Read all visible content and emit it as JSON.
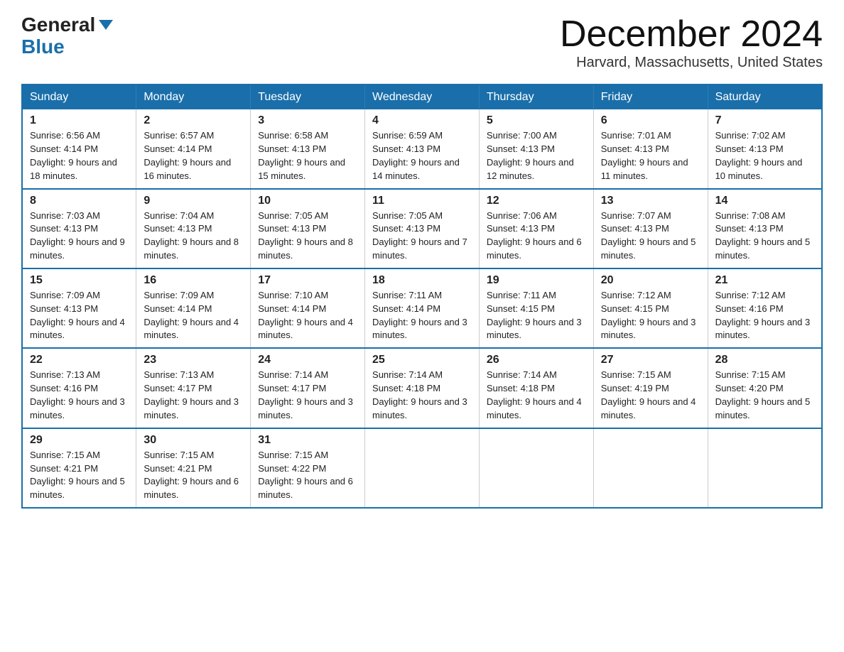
{
  "header": {
    "logo_general": "General",
    "logo_blue": "Blue",
    "month_title": "December 2024",
    "location": "Harvard, Massachusetts, United States"
  },
  "weekdays": [
    "Sunday",
    "Monday",
    "Tuesday",
    "Wednesday",
    "Thursday",
    "Friday",
    "Saturday"
  ],
  "weeks": [
    [
      {
        "day": "1",
        "sunrise": "6:56 AM",
        "sunset": "4:14 PM",
        "daylight": "9 hours and 18 minutes."
      },
      {
        "day": "2",
        "sunrise": "6:57 AM",
        "sunset": "4:14 PM",
        "daylight": "9 hours and 16 minutes."
      },
      {
        "day": "3",
        "sunrise": "6:58 AM",
        "sunset": "4:13 PM",
        "daylight": "9 hours and 15 minutes."
      },
      {
        "day": "4",
        "sunrise": "6:59 AM",
        "sunset": "4:13 PM",
        "daylight": "9 hours and 14 minutes."
      },
      {
        "day": "5",
        "sunrise": "7:00 AM",
        "sunset": "4:13 PM",
        "daylight": "9 hours and 12 minutes."
      },
      {
        "day": "6",
        "sunrise": "7:01 AM",
        "sunset": "4:13 PM",
        "daylight": "9 hours and 11 minutes."
      },
      {
        "day": "7",
        "sunrise": "7:02 AM",
        "sunset": "4:13 PM",
        "daylight": "9 hours and 10 minutes."
      }
    ],
    [
      {
        "day": "8",
        "sunrise": "7:03 AM",
        "sunset": "4:13 PM",
        "daylight": "9 hours and 9 minutes."
      },
      {
        "day": "9",
        "sunrise": "7:04 AM",
        "sunset": "4:13 PM",
        "daylight": "9 hours and 8 minutes."
      },
      {
        "day": "10",
        "sunrise": "7:05 AM",
        "sunset": "4:13 PM",
        "daylight": "9 hours and 8 minutes."
      },
      {
        "day": "11",
        "sunrise": "7:05 AM",
        "sunset": "4:13 PM",
        "daylight": "9 hours and 7 minutes."
      },
      {
        "day": "12",
        "sunrise": "7:06 AM",
        "sunset": "4:13 PM",
        "daylight": "9 hours and 6 minutes."
      },
      {
        "day": "13",
        "sunrise": "7:07 AM",
        "sunset": "4:13 PM",
        "daylight": "9 hours and 5 minutes."
      },
      {
        "day": "14",
        "sunrise": "7:08 AM",
        "sunset": "4:13 PM",
        "daylight": "9 hours and 5 minutes."
      }
    ],
    [
      {
        "day": "15",
        "sunrise": "7:09 AM",
        "sunset": "4:13 PM",
        "daylight": "9 hours and 4 minutes."
      },
      {
        "day": "16",
        "sunrise": "7:09 AM",
        "sunset": "4:14 PM",
        "daylight": "9 hours and 4 minutes."
      },
      {
        "day": "17",
        "sunrise": "7:10 AM",
        "sunset": "4:14 PM",
        "daylight": "9 hours and 4 minutes."
      },
      {
        "day": "18",
        "sunrise": "7:11 AM",
        "sunset": "4:14 PM",
        "daylight": "9 hours and 3 minutes."
      },
      {
        "day": "19",
        "sunrise": "7:11 AM",
        "sunset": "4:15 PM",
        "daylight": "9 hours and 3 minutes."
      },
      {
        "day": "20",
        "sunrise": "7:12 AM",
        "sunset": "4:15 PM",
        "daylight": "9 hours and 3 minutes."
      },
      {
        "day": "21",
        "sunrise": "7:12 AM",
        "sunset": "4:16 PM",
        "daylight": "9 hours and 3 minutes."
      }
    ],
    [
      {
        "day": "22",
        "sunrise": "7:13 AM",
        "sunset": "4:16 PM",
        "daylight": "9 hours and 3 minutes."
      },
      {
        "day": "23",
        "sunrise": "7:13 AM",
        "sunset": "4:17 PM",
        "daylight": "9 hours and 3 minutes."
      },
      {
        "day": "24",
        "sunrise": "7:14 AM",
        "sunset": "4:17 PM",
        "daylight": "9 hours and 3 minutes."
      },
      {
        "day": "25",
        "sunrise": "7:14 AM",
        "sunset": "4:18 PM",
        "daylight": "9 hours and 3 minutes."
      },
      {
        "day": "26",
        "sunrise": "7:14 AM",
        "sunset": "4:18 PM",
        "daylight": "9 hours and 4 minutes."
      },
      {
        "day": "27",
        "sunrise": "7:15 AM",
        "sunset": "4:19 PM",
        "daylight": "9 hours and 4 minutes."
      },
      {
        "day": "28",
        "sunrise": "7:15 AM",
        "sunset": "4:20 PM",
        "daylight": "9 hours and 5 minutes."
      }
    ],
    [
      {
        "day": "29",
        "sunrise": "7:15 AM",
        "sunset": "4:21 PM",
        "daylight": "9 hours and 5 minutes."
      },
      {
        "day": "30",
        "sunrise": "7:15 AM",
        "sunset": "4:21 PM",
        "daylight": "9 hours and 6 minutes."
      },
      {
        "day": "31",
        "sunrise": "7:15 AM",
        "sunset": "4:22 PM",
        "daylight": "9 hours and 6 minutes."
      },
      null,
      null,
      null,
      null
    ]
  ],
  "labels": {
    "sunrise_prefix": "Sunrise: ",
    "sunset_prefix": "Sunset: ",
    "daylight_prefix": "Daylight: "
  }
}
